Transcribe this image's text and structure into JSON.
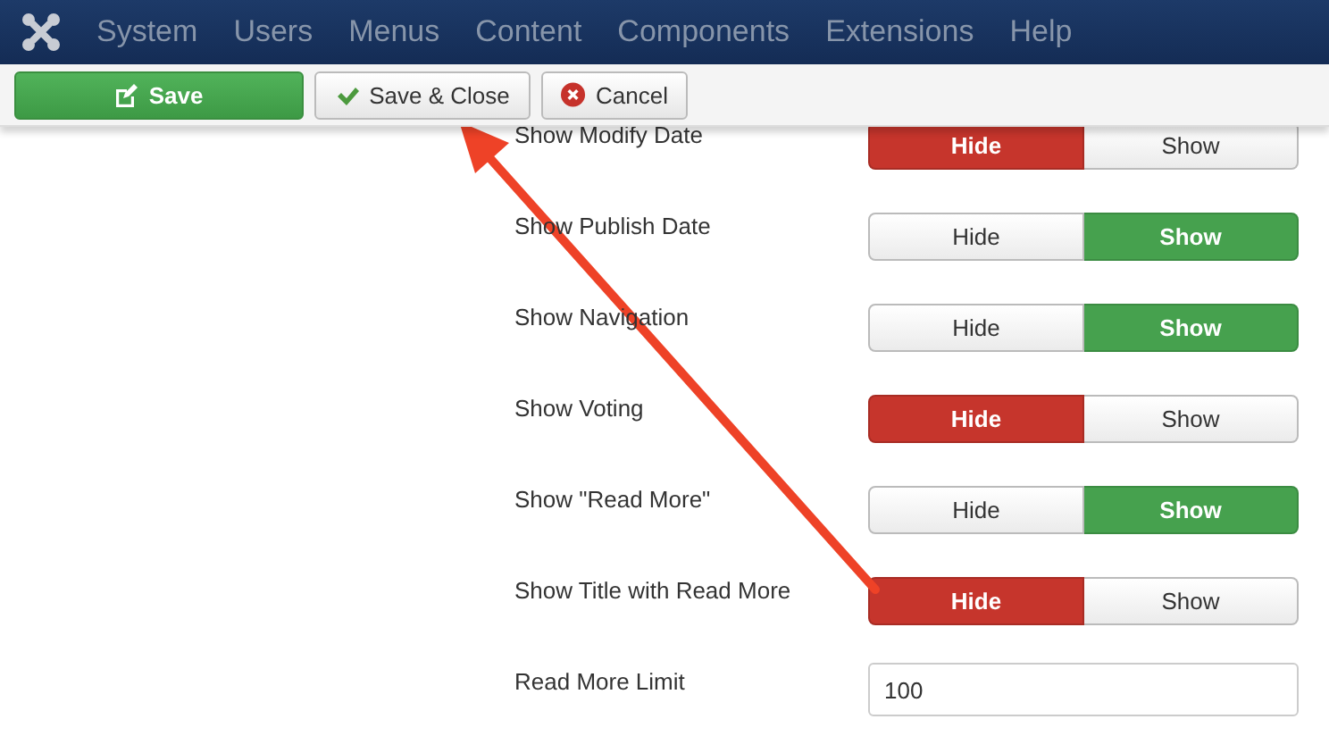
{
  "menu": [
    "System",
    "Users",
    "Menus",
    "Content",
    "Components",
    "Extensions",
    "Help"
  ],
  "toolbar": [
    {
      "label": "Save",
      "kind": "save"
    },
    {
      "label": "Save & Close",
      "kind": "save-close"
    },
    {
      "label": "Cancel",
      "kind": "cancel"
    }
  ],
  "rows": [
    {
      "label": "Show Modify Date",
      "kind": "toggle",
      "options": [
        {
          "label": "Hide",
          "kind": "negative",
          "selected": true
        },
        {
          "label": "Show",
          "kind": "positive",
          "selected": false
        }
      ]
    },
    {
      "label": "Show Publish Date",
      "kind": "toggle",
      "options": [
        {
          "label": "Hide",
          "kind": "negative",
          "selected": false
        },
        {
          "label": "Show",
          "kind": "positive",
          "selected": true
        }
      ]
    },
    {
      "label": "Show Navigation",
      "kind": "toggle",
      "options": [
        {
          "label": "Hide",
          "kind": "negative",
          "selected": false
        },
        {
          "label": "Show",
          "kind": "positive",
          "selected": true
        }
      ]
    },
    {
      "label": "Show Voting",
      "kind": "toggle",
      "options": [
        {
          "label": "Hide",
          "kind": "negative",
          "selected": true
        },
        {
          "label": "Show",
          "kind": "positive",
          "selected": false
        }
      ]
    },
    {
      "label": "Show \"Read More\"",
      "kind": "toggle",
      "options": [
        {
          "label": "Hide",
          "kind": "negative",
          "selected": false
        },
        {
          "label": "Show",
          "kind": "positive",
          "selected": true
        }
      ]
    },
    {
      "label": "Show Title with Read More",
      "kind": "toggle",
      "options": [
        {
          "label": "Hide",
          "kind": "negative",
          "selected": true
        },
        {
          "label": "Show",
          "kind": "positive",
          "selected": false
        }
      ]
    },
    {
      "label": "Read More Limit",
      "kind": "input",
      "value": "100"
    }
  ]
}
